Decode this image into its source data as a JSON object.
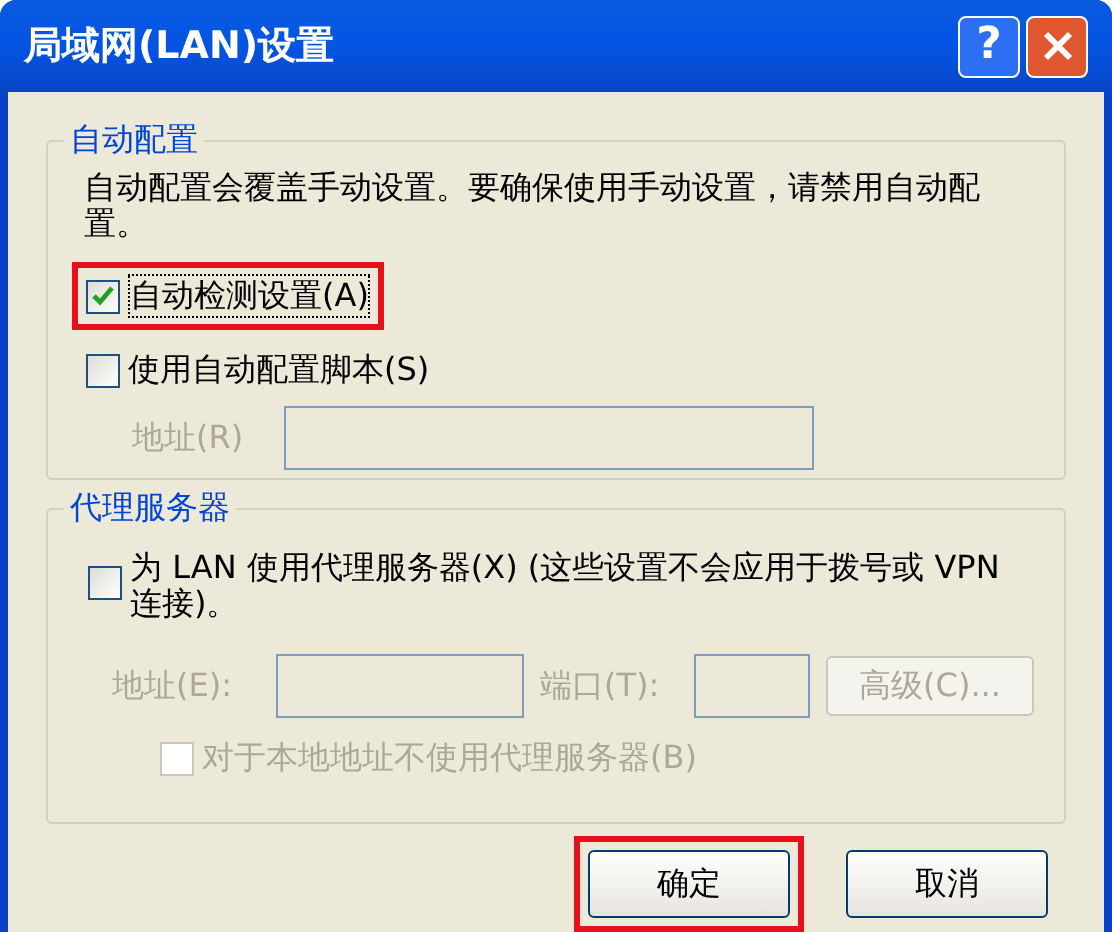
{
  "window": {
    "title": "局域网(LAN)设置",
    "help_label": "?"
  },
  "auto_config": {
    "title": "自动配置",
    "description": "自动配置会覆盖手动设置。要确保使用手动设置，请禁用自动配置。",
    "options": [
      {
        "label": "自动检测设置(A)",
        "checked": true,
        "highlighted": true
      },
      {
        "label": "使用自动配置脚本(S)",
        "checked": false,
        "highlighted": false
      }
    ],
    "address": {
      "label": "地址(R)",
      "disabled": true
    }
  },
  "proxy": {
    "title": "代理服务器",
    "option": {
      "label": "为 LAN 使用代理服务器(X) (这些设置不会应用于拨号或 VPN 连接)。",
      "checked": false
    },
    "address_label": "地址(E):",
    "port_label": "端口(T):",
    "advanced_button": "高级(C)...",
    "disabled": true,
    "bypass": {
      "label": "对于本地地址不使用代理服务器(B)",
      "checked": false
    }
  },
  "buttons": [
    {
      "label": "确定",
      "highlighted": true
    },
    {
      "label": "取消",
      "highlighted": false
    }
  ]
}
